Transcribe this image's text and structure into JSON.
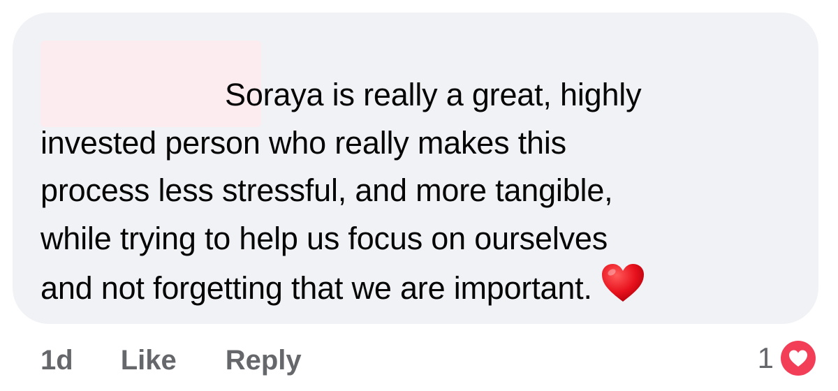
{
  "comment": {
    "lines": [
      "Soraya is really a great, highly",
      "invested person who really makes this",
      "process less stressful, and more tangible,",
      "while trying to help us focus on ourselves",
      "and not forgetting that we are important."
    ],
    "emoji": "heart-emoji"
  },
  "actions": {
    "time": "1d",
    "like_label": "Like",
    "reply_label": "Reply"
  },
  "reactions": {
    "count": "1",
    "type": "love-reaction-icon"
  },
  "colors": {
    "bubble_bg": "#f0f2f5",
    "text": "#050505",
    "meta_text": "#65676b",
    "love_red": "#f33e58",
    "redaction": "#fcebef"
  }
}
